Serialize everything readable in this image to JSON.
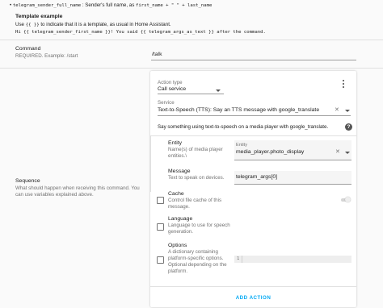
{
  "top_bullet": {
    "code1": "telegram_sender_full_name",
    "mid": ": Sender's full name, as",
    "code2": "first_name + \" \" + last_name"
  },
  "template_example": {
    "title": "Template example",
    "line1_a": "Use",
    "line1_code": "{{ }}",
    "line1_b": "to indicate that it is a template, as usual in Home Assistant.",
    "line2": "Hi {{ telegram_sender_first_name }}! You said {{ telegram_args_as_text }} after the command."
  },
  "command": {
    "title": "Command",
    "desc": "REQUIRED. Example: /start",
    "value": "/talk"
  },
  "sequence": {
    "title": "Sequence",
    "desc": "What should happen when receiving this command. You can use variables explained above."
  },
  "action": {
    "type_label": "Action type",
    "type_value": "Call service",
    "service_label": "Service",
    "service_value": "Text-to-Speech (TTS): Say an TTS message with google_translate",
    "service_desc": "Say something using text-to-speech on a media player with google_translate."
  },
  "fields": {
    "entity": {
      "title": "Entity",
      "desc": "Name(s) of media player entities.\\",
      "input_label": "Entity",
      "value": "media_player.photo_display"
    },
    "message": {
      "title": "Message",
      "desc": "Text to speak on devices.",
      "value": "telegram_args[0]"
    },
    "cache": {
      "title": "Cache",
      "desc": "Control file cache of this message."
    },
    "language": {
      "title": "Language",
      "desc": "Language to use for speech generation."
    },
    "options": {
      "title": "Options",
      "desc": "A dictionary containing platform-specific options. Optional depending on the platform.",
      "code_line": "1"
    }
  },
  "add_action_label": "ADD ACTION",
  "colors": {
    "accent": "#03a9f4",
    "card": "#ffffff",
    "background": "#fafafa"
  },
  "icons": [
    "more-vert-icon",
    "help-icon",
    "close-icon",
    "caret-down-icon"
  ]
}
